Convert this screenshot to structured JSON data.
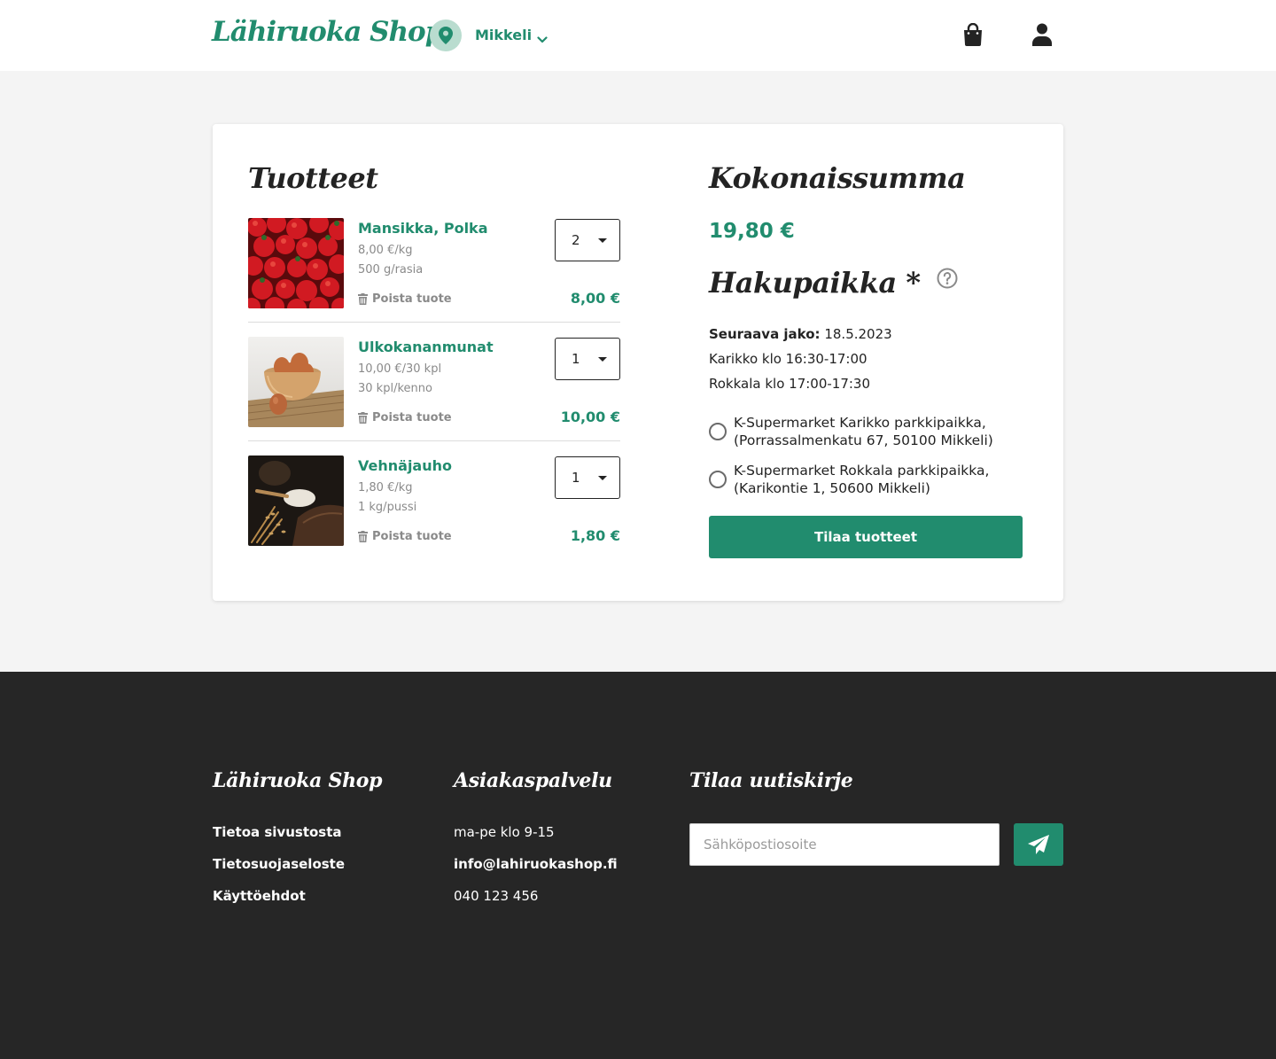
{
  "header": {
    "logo": "Lähiruoka Shop",
    "location": "Mikkeli"
  },
  "cart": {
    "title": "Tuotteet",
    "items": [
      {
        "name": "Mansikka, Polka",
        "price_unit": "8,00 €/kg",
        "package": "500 g/rasia",
        "remove_label": "Poista tuote",
        "quantity": "2",
        "total": "8,00 €",
        "image": "strawberries"
      },
      {
        "name": "Ulkokananmunat",
        "price_unit": "10,00 €/30 kpl",
        "package": "30 kpl/kenno",
        "remove_label": "Poista tuote",
        "quantity": "1",
        "total": "10,00 €",
        "image": "eggs"
      },
      {
        "name": "Vehnäjauho",
        "price_unit": "1,80 €/kg",
        "package": "1 kg/pussi",
        "remove_label": "Poista tuote",
        "quantity": "1",
        "total": "1,80 €",
        "image": "flour"
      }
    ]
  },
  "summary": {
    "total_title": "Kokonaissumma",
    "total_value": "19,80 €",
    "pickup_title": "Hakupaikka *",
    "next_label": "Seuraava jako:",
    "next_date": "18.5.2023",
    "schedule": [
      "Karikko klo 16:30-17:00",
      "Rokkala klo 17:00-17:30"
    ],
    "options": [
      {
        "line1": "K-Supermarket Karikko parkkipaikka,",
        "line2": "(Porrassalmenkatu 67, 50100 Mikkeli)"
      },
      {
        "line1": "K-Supermarket Rokkala parkkipaikka,",
        "line2": "(Karikontie 1, 50600 Mikkeli)"
      }
    ],
    "order_button": "Tilaa tuotteet"
  },
  "footer": {
    "col1": {
      "title": "Lähiruoka Shop",
      "links": [
        "Tietoa sivustosta",
        "Tietosuojaseloste",
        "Käyttöehdot"
      ]
    },
    "col2": {
      "title": "Asiakaspalvelu",
      "hours": "ma-pe klo 9-15",
      "email": "info@lahiruokashop.fi",
      "phone": "040 123 456"
    },
    "col3": {
      "title": "Tilaa uutiskirje",
      "email_placeholder": "Sähköpostiosoite"
    }
  },
  "colors": {
    "brand": "#218c6e",
    "footer_bg": "#262626",
    "page_bg": "#f4f4f4"
  }
}
